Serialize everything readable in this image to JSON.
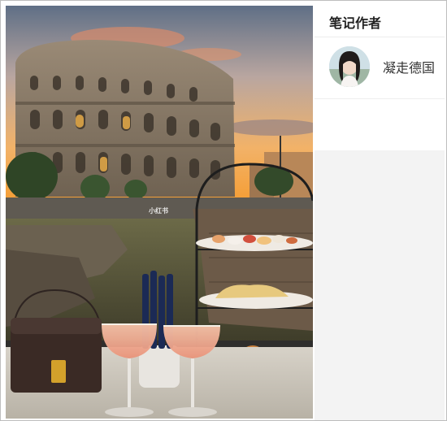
{
  "sidebar": {
    "title": "笔记作者",
    "author": {
      "name": "凝走德国",
      "avatar_icon": "user-avatar"
    }
  },
  "photo": {
    "description_icon": "colosseum-photo",
    "watermark": "小红书",
    "colors": {
      "sky_top": "#6d7b8c",
      "sunset": "#f3a33c",
      "stone": "#8a7a66"
    }
  }
}
